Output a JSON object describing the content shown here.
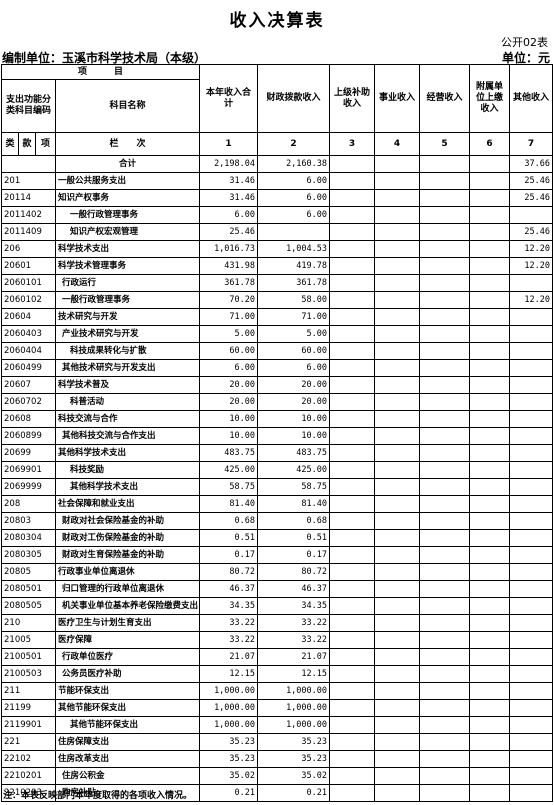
{
  "title": "收入决算表",
  "form_no": "公开02表",
  "unit_label": "编制单位：玉溪市科学技术局（本级）",
  "unit_right": "单位：元",
  "header": {
    "project": "项　　　目",
    "code_col": "支出功能分类科目编码",
    "name_col": "科目名称",
    "lei": "类",
    "kuan": "款",
    "xiang": "项",
    "lanci": "栏　　次",
    "cols": [
      "本年收入合计",
      "财政拨款收入",
      "上级补助收入",
      "事业收入",
      "经营收入",
      "附属单位上缴收入",
      "其他收入"
    ],
    "col_nums": [
      "1",
      "2",
      "3",
      "4",
      "5",
      "6",
      "7"
    ]
  },
  "rows": [
    {
      "code": "",
      "name": "合计",
      "lvl": "total",
      "c1": "2,198.04",
      "c2": "2,160.38",
      "c7": "37.66"
    },
    {
      "code": "201",
      "name": "一般公共服务支出",
      "lvl": "0",
      "c1": "31.46",
      "c2": "6.00",
      "c7": "25.46"
    },
    {
      "code": "20114",
      "name": "知识产权事务",
      "lvl": "0",
      "c1": "31.46",
      "c2": "6.00",
      "c7": "25.46"
    },
    {
      "code": "2011402",
      "name": "一般行政管理事务",
      "lvl": "2",
      "c1": "6.00",
      "c2": "6.00",
      "c7": ""
    },
    {
      "code": "2011409",
      "name": "知识产权宏观管理",
      "lvl": "2",
      "c1": "25.46",
      "c2": "",
      "c7": "25.46"
    },
    {
      "code": "206",
      "name": "科学技术支出",
      "lvl": "0",
      "c1": "1,016.73",
      "c2": "1,004.53",
      "c7": "12.20"
    },
    {
      "code": "20601",
      "name": "科学技术管理事务",
      "lvl": "0",
      "c1": "431.98",
      "c2": "419.78",
      "c7": "12.20"
    },
    {
      "code": "2060101",
      "name": "行政运行",
      "lvl": "1",
      "c1": "361.78",
      "c2": "361.78",
      "c7": ""
    },
    {
      "code": "2060102",
      "name": "一般行政管理事务",
      "lvl": "1",
      "c1": "70.20",
      "c2": "58.00",
      "c7": "12.20"
    },
    {
      "code": "20604",
      "name": "技术研究与开发",
      "lvl": "0",
      "c1": "71.00",
      "c2": "71.00",
      "c7": ""
    },
    {
      "code": "2060403",
      "name": "产业技术研究与开发",
      "lvl": "1",
      "c1": "5.00",
      "c2": "5.00",
      "c7": ""
    },
    {
      "code": "2060404",
      "name": "科技成果转化与扩散",
      "lvl": "2",
      "c1": "60.00",
      "c2": "60.00",
      "c7": ""
    },
    {
      "code": "2060499",
      "name": "其他技术研究与开发支出",
      "lvl": "1",
      "c1": "6.00",
      "c2": "6.00",
      "c7": ""
    },
    {
      "code": "20607",
      "name": "科学技术普及",
      "lvl": "0",
      "c1": "20.00",
      "c2": "20.00",
      "c7": ""
    },
    {
      "code": "2060702",
      "name": "科普活动",
      "lvl": "2",
      "c1": "20.00",
      "c2": "20.00",
      "c7": ""
    },
    {
      "code": "20608",
      "name": "科技交流与合作",
      "lvl": "0",
      "c1": "10.00",
      "c2": "10.00",
      "c7": ""
    },
    {
      "code": "2060899",
      "name": "其他科技交流与合作支出",
      "lvl": "1",
      "c1": "10.00",
      "c2": "10.00",
      "c7": ""
    },
    {
      "code": "20699",
      "name": "其他科学技术支出",
      "lvl": "0",
      "c1": "483.75",
      "c2": "483.75",
      "c7": ""
    },
    {
      "code": "2069901",
      "name": "科技奖励",
      "lvl": "2",
      "c1": "425.00",
      "c2": "425.00",
      "c7": ""
    },
    {
      "code": "2069999",
      "name": "其他科学技术支出",
      "lvl": "2",
      "c1": "58.75",
      "c2": "58.75",
      "c7": ""
    },
    {
      "code": "208",
      "name": "社会保障和就业支出",
      "lvl": "0",
      "c1": "81.40",
      "c2": "81.40",
      "c7": ""
    },
    {
      "code": "20803",
      "name": "财政对社会保险基金的补助",
      "lvl": "1",
      "c1": "0.68",
      "c2": "0.68",
      "c7": ""
    },
    {
      "code": "2080304",
      "name": "财政对工伤保险基金的补助",
      "lvl": "1",
      "c1": "0.51",
      "c2": "0.51",
      "c7": ""
    },
    {
      "code": "2080305",
      "name": "财政对生育保险基金的补助",
      "lvl": "1",
      "c1": "0.17",
      "c2": "0.17",
      "c7": ""
    },
    {
      "code": "20805",
      "name": "行政事业单位离退休",
      "lvl": "0",
      "c1": "80.72",
      "c2": "80.72",
      "c7": ""
    },
    {
      "code": "2080501",
      "name": "归口管理的行政单位离退休",
      "lvl": "1",
      "c1": "46.37",
      "c2": "46.37",
      "c7": ""
    },
    {
      "code": "2080505",
      "name": "机关事业单位基本养老保险缴费支出",
      "lvl": "1",
      "c1": "34.35",
      "c2": "34.35",
      "c7": ""
    },
    {
      "code": "210",
      "name": "医疗卫生与计划生育支出",
      "lvl": "0",
      "c1": "33.22",
      "c2": "33.22",
      "c7": ""
    },
    {
      "code": "21005",
      "name": "医疗保障",
      "lvl": "0",
      "c1": "33.22",
      "c2": "33.22",
      "c7": ""
    },
    {
      "code": "2100501",
      "name": "行政单位医疗",
      "lvl": "1",
      "c1": "21.07",
      "c2": "21.07",
      "c7": ""
    },
    {
      "code": "2100503",
      "name": "公务员医疗补助",
      "lvl": "1",
      "c1": "12.15",
      "c2": "12.15",
      "c7": ""
    },
    {
      "code": "211",
      "name": "节能环保支出",
      "lvl": "0",
      "c1": "1,000.00",
      "c2": "1,000.00",
      "c7": ""
    },
    {
      "code": "21199",
      "name": "其他节能环保支出",
      "lvl": "0",
      "c1": "1,000.00",
      "c2": "1,000.00",
      "c7": ""
    },
    {
      "code": "2119901",
      "name": "其他节能环保支出",
      "lvl": "2",
      "c1": "1,000.00",
      "c2": "1,000.00",
      "c7": ""
    },
    {
      "code": "221",
      "name": "住房保障支出",
      "lvl": "0",
      "c1": "35.23",
      "c2": "35.23",
      "c7": ""
    },
    {
      "code": "22102",
      "name": "住房改革支出",
      "lvl": "0",
      "c1": "35.23",
      "c2": "35.23",
      "c7": ""
    },
    {
      "code": "2210201",
      "name": "住房公积金",
      "lvl": "1",
      "c1": "35.02",
      "c2": "35.02",
      "c7": ""
    },
    {
      "code": "2210203",
      "name": "购房补贴",
      "lvl": "1",
      "c1": "0.21",
      "c2": "0.21",
      "c7": ""
    }
  ],
  "note": "注：本表反映部门本年度取得的各项收入情况。"
}
